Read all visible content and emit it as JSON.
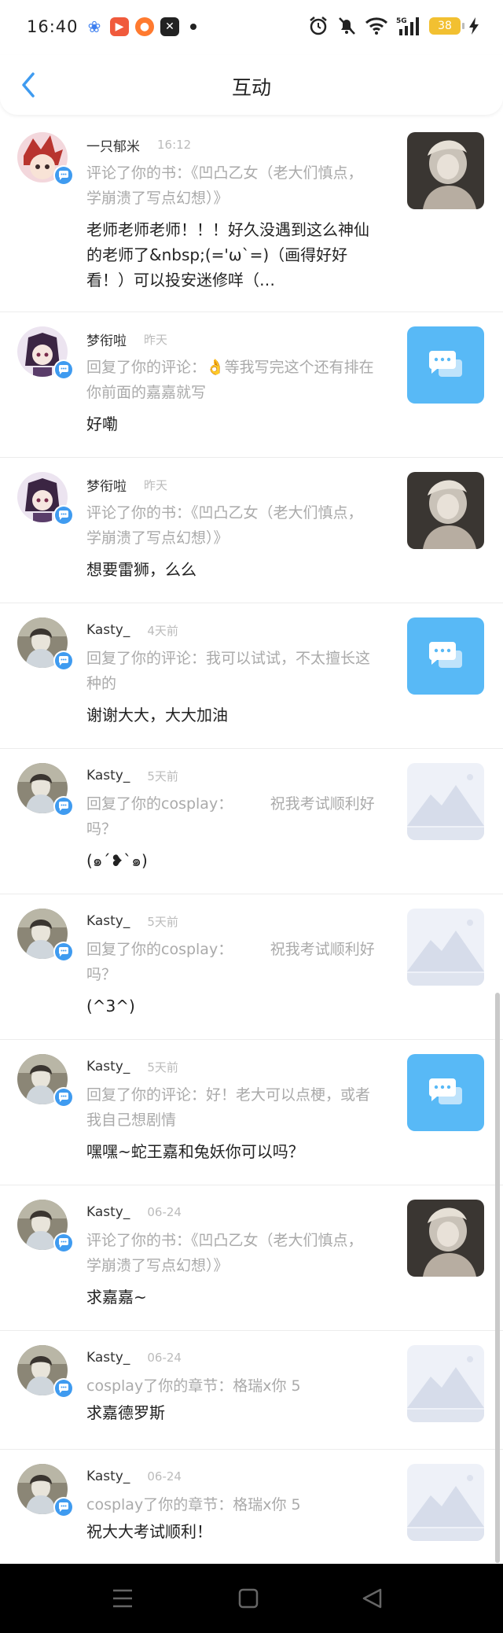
{
  "status_bar": {
    "time": "16:40",
    "battery": "38"
  },
  "header": {
    "title": "互动"
  },
  "items": [
    {
      "name": "一只郁米",
      "time": "16:12",
      "action": "评论了你的书：《凹凸乙女（老大们慎点，学崩溃了写点幻想）》",
      "message": "老师老师老师！！！好久没遇到这么神仙的老师了&nbsp;(='ω`=)（画得好好看！）可以投安迷修咩（…",
      "thumb": "cover"
    },
    {
      "name": "梦衔啦",
      "time": "昨天",
      "action": "回复了你的评论：👌等我写完这个还有排在你前面的嘉嘉就写",
      "message": "好嘞",
      "thumb": "chat"
    },
    {
      "name": "梦衔啦",
      "time": "昨天",
      "action": "评论了你的书：《凹凸乙女（老大们慎点，学崩溃了写点幻想）》",
      "message": "想要雷狮，么么",
      "thumb": "cover"
    },
    {
      "name": "Kasty_",
      "time": "4天前",
      "action": "回复了你的评论：我可以试试，不太擅长这种的",
      "message": "谢谢大大，大大加油",
      "thumb": "chat"
    },
    {
      "name": "Kasty_",
      "time": "5天前",
      "action": "回复了你的cosplay：　　　祝我考试顺利好吗？",
      "message": "(๑ˊ❥ˋ๑)",
      "thumb": "placeholder"
    },
    {
      "name": "Kasty_",
      "time": "5天前",
      "action": "回复了你的cosplay：　　　祝我考试顺利好吗？",
      "message": "(^3^)",
      "thumb": "placeholder"
    },
    {
      "name": "Kasty_",
      "time": "5天前",
      "action": "回复了你的评论：好！老大可以点梗，或者我自己想剧情",
      "message": "嘿嘿~蛇王嘉和兔妖你可以吗？",
      "thumb": "chat"
    },
    {
      "name": "Kasty_",
      "time": "06-24",
      "action": "评论了你的书：《凹凸乙女（老大们慎点，学崩溃了写点幻想）》",
      "message": "求嘉嘉~",
      "thumb": "cover"
    },
    {
      "name": "Kasty_",
      "time": "06-24",
      "action": "cosplay了你的章节：格瑞x你 5",
      "message": "求嘉德罗斯",
      "thumb": "placeholder"
    },
    {
      "name": "Kasty_",
      "time": "06-24",
      "action": "cosplay了你的章节：格瑞x你 5",
      "message": "祝大大考试顺利！",
      "thumb": "placeholder"
    }
  ]
}
